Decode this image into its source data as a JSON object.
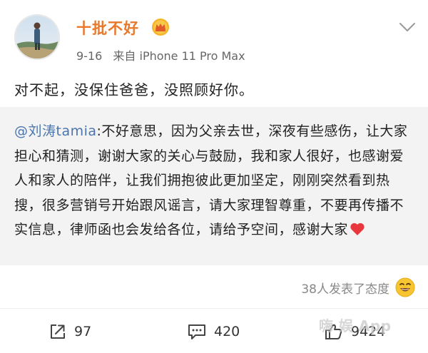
{
  "post": {
    "author": "十批不好",
    "date": "9-16",
    "source": "来自 iPhone 11 Pro Max",
    "text": "对不起，没保住爸爸，没照顾好你。"
  },
  "quote": {
    "mention": "@刘涛tamia",
    "text": ":不好意思，因为父亲去世，深夜有些感伤，让大家担心和猜测，谢谢大家的关心与鼓励，我和家人很好，也感谢爱人和家人的陪伴，让我们拥抱彼此更加坚定，刚刚突然看到热搜，很多营销号开始跟风谣言，请大家理智尊重，不要再传播不实信息，律师函也会发给各位，请给予空间，感谢大家"
  },
  "reactions": {
    "text": "38人发表了态度"
  },
  "actions": {
    "repost_count": "97",
    "comment_count": "420",
    "like_count": "9424"
  },
  "watermark": "嗨 娱 App",
  "colors": {
    "author": "#e8782a",
    "mention": "#4a75ad",
    "quote_bg": "#f3f3f3",
    "heart": "#e8383d"
  },
  "icons": {
    "vip": "crown-badge-icon",
    "menu": "chevron-down-icon",
    "heart": "heart-emoji-icon",
    "reaction": "smile-emoji-icon",
    "repost": "repost-icon",
    "comment": "comment-icon",
    "like": "thumbs-up-icon"
  }
}
